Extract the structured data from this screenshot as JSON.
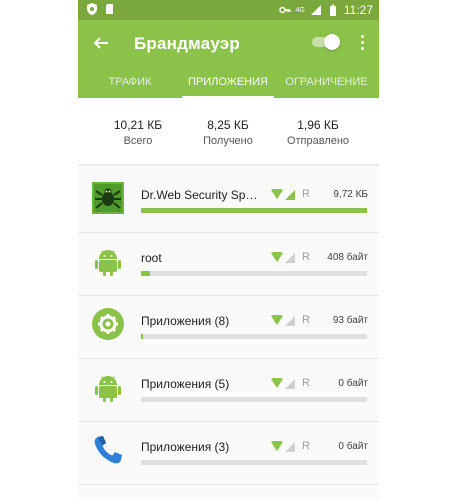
{
  "status_bar": {
    "time": "11:27",
    "network": "4G"
  },
  "header": {
    "title": "Брандмауэр",
    "firewall_enabled": true
  },
  "tabs": [
    {
      "label": "ТРАФИК",
      "active": false
    },
    {
      "label": "ПРИЛОЖЕНИЯ",
      "active": true
    },
    {
      "label": "ОГРАНИЧЕНИЕ",
      "active": false
    }
  ],
  "summary": [
    {
      "value": "10,21 КБ",
      "label": "Всего"
    },
    {
      "value": "8,25 КБ",
      "label": "Получено"
    },
    {
      "value": "1,96 КБ",
      "label": "Отправлено"
    }
  ],
  "apps": [
    {
      "name": "Dr.Web Security Space",
      "roaming": "R",
      "size": "9,72 КБ",
      "usage": 1.0,
      "icon": "drweb-spider-icon"
    },
    {
      "name": "root",
      "roaming": "R",
      "size": "408 байт",
      "usage": 0.04,
      "icon": "android-icon"
    },
    {
      "name": "Приложения (8)",
      "roaming": "R",
      "size": "93 байт",
      "usage": 0.01,
      "icon": "settings-gear-icon"
    },
    {
      "name": "Приложения (5)",
      "roaming": "R",
      "size": "0 байт",
      "usage": 0.0,
      "icon": "android-icon"
    },
    {
      "name": "Приложения (3)",
      "roaming": "R",
      "size": "0 байт",
      "usage": 0.0,
      "icon": "phone-icon"
    }
  ],
  "colors": {
    "primary": "#8bc34a",
    "primary_dark": "#7aa83c",
    "bar_track": "#e0e0e0"
  }
}
